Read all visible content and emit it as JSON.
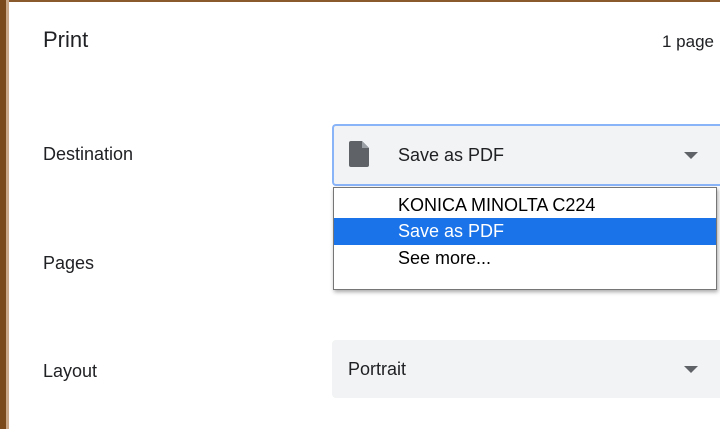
{
  "dialog": {
    "title": "Print",
    "page_count": "1 page"
  },
  "destination": {
    "label": "Destination",
    "selected": "Save as PDF",
    "icon": "document-icon",
    "options": [
      {
        "label": "KONICA MINOLTA C224",
        "highlighted": false
      },
      {
        "label": "Save as PDF",
        "highlighted": true
      },
      {
        "label": "See more...",
        "highlighted": false
      }
    ]
  },
  "pages": {
    "label": "Pages"
  },
  "layout": {
    "label": "Layout",
    "selected": "Portrait"
  },
  "colors": {
    "highlight": "#1a73e8",
    "focus_border": "#8ab4f8",
    "select_bg": "#f1f3f4",
    "window_edge": "#7a4a1c"
  }
}
